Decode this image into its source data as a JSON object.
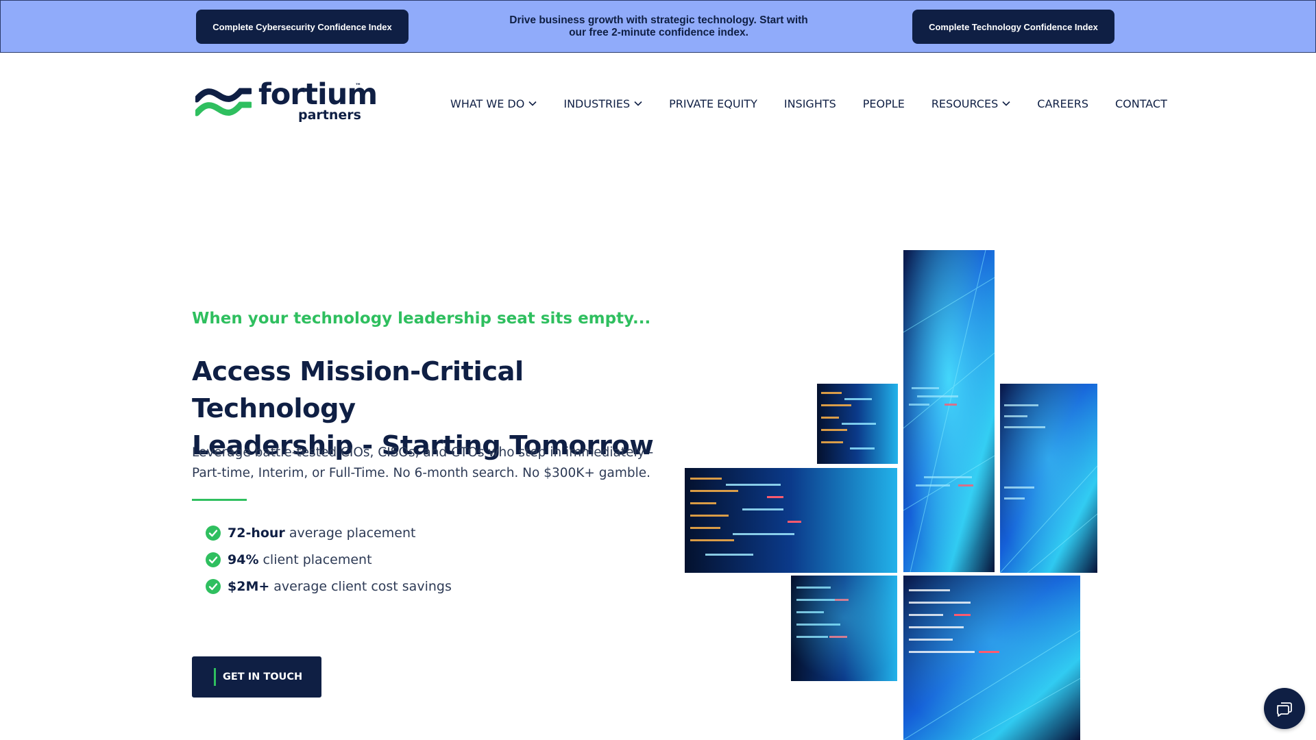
{
  "promo": {
    "left_button": "Complete Cybersecurity Confidence Index",
    "message": "Drive business growth with strategic technology. Start with our free 2-minute confidence index.",
    "right_button": "Complete Technology Confidence Index"
  },
  "brand": {
    "name": "fortium",
    "sub": "partners",
    "trademark": "™",
    "colors": {
      "navy": "#0f1f44",
      "green": "#2fbf5f",
      "banner": "#90abfa"
    }
  },
  "nav": {
    "items": [
      {
        "label": "WHAT WE DO",
        "dropdown": true
      },
      {
        "label": "INDUSTRIES",
        "dropdown": true
      },
      {
        "label": "PRIVATE EQUITY",
        "dropdown": false
      },
      {
        "label": "INSIGHTS",
        "dropdown": false
      },
      {
        "label": "PEOPLE",
        "dropdown": false
      },
      {
        "label": "RESOURCES",
        "dropdown": true
      },
      {
        "label": "CAREERS",
        "dropdown": false
      },
      {
        "label": "CONTACT",
        "dropdown": false
      }
    ]
  },
  "hero": {
    "eyebrow": "When your technology leadership seat sits empty...",
    "headline_line1": "Access Mission-Critical Technology",
    "headline_line2": "Leadership - Starting Tomorrow",
    "subtext": "Leverage battle-tested CIOs, CISOs, and CTOs who step in immediately - Part-time, Interim, or Full-Time. No 6-month search. No $300K+ gamble.",
    "stats": [
      {
        "strong": "72-hour",
        "rest": "average placement"
      },
      {
        "strong": "94%",
        "rest": "client placement"
      },
      {
        "strong": "$2M+",
        "rest": "average client cost savings"
      }
    ],
    "cta": "GET IN TOUCH"
  },
  "icons": {
    "check": "check-circle-icon",
    "chevron": "chevron-down-icon",
    "chat": "chat-bubble-icon"
  }
}
